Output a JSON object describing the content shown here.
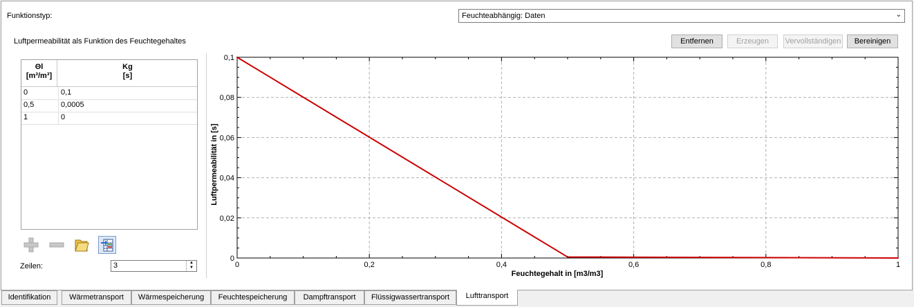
{
  "funktionstyp_label": "Funktionstyp:",
  "funktionstyp_value": "Feuchteabhängig: Daten",
  "section_title": "Luftpermeabilität als Funktion des Feuchtegehaltes",
  "buttons": {
    "remove": "Entfernen",
    "generate": "Erzeugen",
    "complete": "Vervollständigen",
    "clean": "Bereinigen"
  },
  "table": {
    "col1_line1": "Θl",
    "col1_line2": "[m³/m³]",
    "col2_line1": "Kg",
    "col2_line2": "[s]",
    "rows": [
      {
        "x": "0",
        "y": "0,1"
      },
      {
        "x": "0,5",
        "y": "0,0005"
      },
      {
        "x": "1",
        "y": "0"
      }
    ]
  },
  "rows_label": "Zeilen:",
  "rows_value": "3",
  "icons": [
    "add-icon",
    "remove-icon",
    "open-folder-icon",
    "table-import-icon"
  ],
  "chart_data": {
    "type": "line",
    "xlabel": "Feuchtegehalt in [m3/m3]",
    "ylabel": "Luftpermeabilität in [s]",
    "xlim": [
      0,
      1
    ],
    "ylim": [
      0,
      0.1
    ],
    "x_ticks": [
      "0",
      "0,2",
      "0,4",
      "0,6",
      "0,8",
      "1"
    ],
    "y_ticks": [
      "0",
      "0,02",
      "0,04",
      "0,06",
      "0,08",
      "0,1"
    ],
    "grid": true,
    "color": "#cc0000",
    "series": [
      {
        "x": [
          0,
          0.5,
          1
        ],
        "y": [
          0.1,
          0.0005,
          0
        ]
      }
    ]
  },
  "tabs": [
    "Identifikation",
    "Wärmetransport",
    "Wärmespeicherung",
    "Feuchtespeicherung",
    "Dampftransport",
    "Flüssigwassertransport",
    "Lufttransport"
  ],
  "active_tab": "Lufttransport"
}
